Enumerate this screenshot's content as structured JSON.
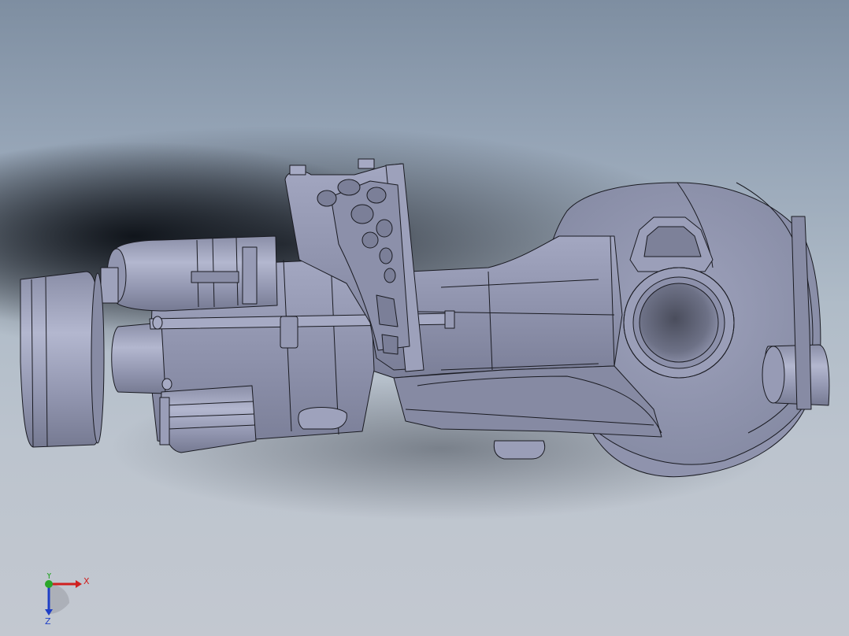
{
  "view": {
    "background_top": "#7e8ea1",
    "background_bottom": "#c3c8d0",
    "model_fill": "#8e92ab",
    "model_highlight": "#a4a8c2",
    "model_edge": "#1a1b22"
  },
  "triad": {
    "x_label": "X",
    "y_label": "Y",
    "z_label": "Z",
    "x_color": "#d0201f",
    "y_color": "#2aa62a",
    "z_color": "#1f3fc6"
  }
}
